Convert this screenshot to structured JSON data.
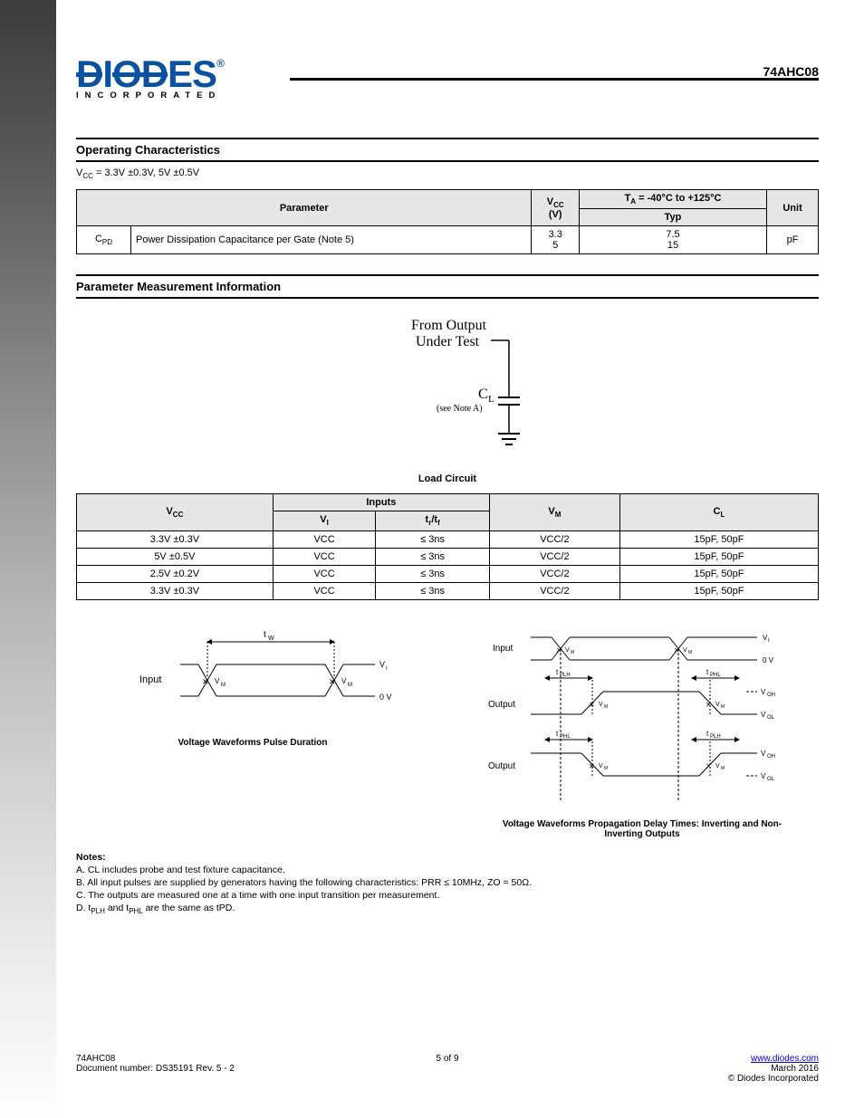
{
  "header": {
    "logo_word": "DIODES",
    "logo_reg": "®",
    "logo_tagline": "INCORPORATED",
    "part_number": "74AHC08"
  },
  "opchar": {
    "title": "Operating Characteristics",
    "subnote_prefix": "V",
    "subnote_sub": "CC",
    "subnote_rest": " = 3.3V ±0.3V, 5V ±0.5V",
    "table": {
      "head_param": "Parameter",
      "head_vcc": "V",
      "head_vcc_sub": "CC",
      "head_ta_html": "T<sub>A</sub> = -40°C to +125°C",
      "head_typ": "Typ",
      "head_unit": "Unit",
      "head_vcc_unit": "(V)",
      "row": {
        "sym": "C",
        "sym_sub": "PD",
        "name": "Power Dissipation Capacitance per Gate (Note 5)",
        "vcc1": "3.3",
        "vcc2": "5",
        "typ1": "7.5",
        "typ2": "15",
        "unit": "pF"
      }
    }
  },
  "pmi": {
    "title": "Parameter Measurement Information",
    "load_fig": {
      "from_output": "From Output",
      "under_test": "Under Test",
      "cl": "C",
      "cl_sub": "L",
      "note": "(see Note A)",
      "caption": "Load Circuit"
    },
    "table": {
      "head_vcc": "V",
      "head_vcc_sub": "CC",
      "head_inputs": "Inputs",
      "head_vi": "V",
      "head_vi_sub": "I",
      "head_trtf": "t",
      "head_trtf_sub": "r",
      "head_slash": "/t",
      "head_trtf_sub2": "f",
      "head_vm": "V",
      "head_vm_sub": "M",
      "head_cl": "C",
      "head_cl_sub": "L",
      "rows": [
        {
          "vcc": "3.3V ±0.3V",
          "vi": "VCC",
          "trtf": "≤ 3ns",
          "vm": "VCC/2",
          "cl": "15pF, 50pF"
        },
        {
          "vcc": "5V ±0.5V",
          "vi": "VCC",
          "trtf": "≤ 3ns",
          "vm": "VCC/2",
          "cl": "15pF, 50pF"
        },
        {
          "vcc": "2.5V ±0.2V",
          "vi": "VCC",
          "trtf": "≤ 3ns",
          "vm": "VCC/2",
          "cl": "15pF, 50pF"
        },
        {
          "vcc": "3.3V ±0.3V",
          "vi": "VCC",
          "trtf": "≤ 3ns",
          "vm": "VCC/2",
          "cl": "15pF, 50pF"
        }
      ]
    },
    "waveform": {
      "left_caption": "Voltage Waveforms Pulse Duration",
      "right_caption": "Voltage Waveforms Propagation Delay Times: Inverting and Non-Inverting Outputs",
      "labels": {
        "input": "Input",
        "output": "Output",
        "vi": "VI",
        "zerov": "0 V",
        "vm": "VM",
        "voh": "VOH",
        "vol": "VOL",
        "tw": "tW",
        "tplh": "tPLH",
        "tphl": "tPHL"
      }
    },
    "notes": {
      "hd": "Notes:",
      "a": "A. CL includes probe and test fixture capacitance.",
      "b": "B. All input pulses are supplied by generators having the following characteristics: PRR ≤ 10MHz, ZO = 50Ω.",
      "c": "C. The outputs are measured one at a time with one input transition per measurement.",
      "d_prefix": "D. t",
      "d_sub_plh": "PLH",
      "d_mid": " and t",
      "d_sub_phl": "PHL",
      "d_rest": " are the same as tPD."
    }
  },
  "footer": {
    "left_part": "74AHC08",
    "left_rev": "Document number: DS35191 Rev. 5 - 2",
    "mid": "5 of 9",
    "right_top": "www.diodes.com",
    "right_bottom": "March 2016",
    "right_copy": "© Diodes Incorporated"
  }
}
